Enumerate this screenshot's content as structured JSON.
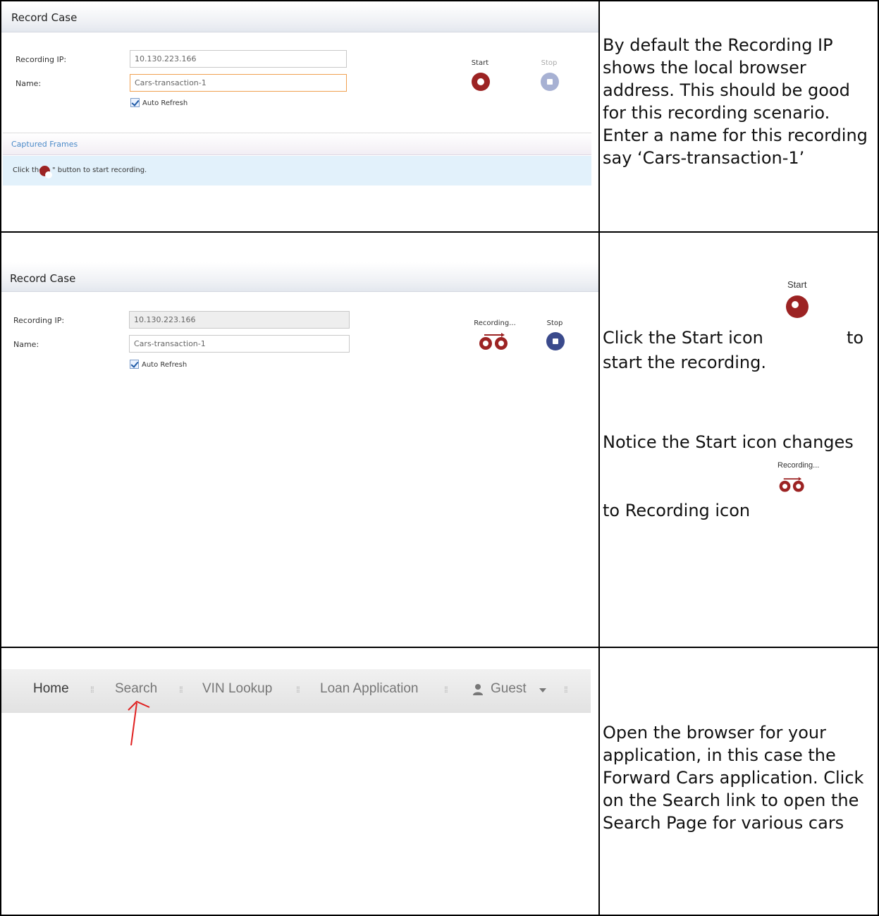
{
  "step1": {
    "panel_title": "Record Case",
    "recording_ip_label": "Recording IP:",
    "recording_ip_value": "10.130.223.166",
    "name_label": "Name:",
    "name_value": "Cars-transaction-1",
    "auto_refresh_label": "Auto Refresh",
    "start_label": "Start",
    "stop_label": "Stop",
    "captured_frames_label": "Captured Frames",
    "hint_prefix": "Click the \"",
    "hint_suffix": "\" button to start recording.",
    "instruction": "By default the Recording IP shows the local browser address. This should be good for this recording scenario. Enter a name for this recording say ‘Cars-transaction-1’"
  },
  "step2": {
    "panel_title": "Record Case",
    "recording_ip_label": "Recording IP:",
    "recording_ip_value": "10.130.223.166",
    "name_label": "Name:",
    "name_value": "Cars-transaction-1",
    "auto_refresh_label": "Auto Refresh",
    "recording_label": "Recording...",
    "stop_label": "Stop",
    "instruction_a1": "Click the Start icon",
    "instruction_a2": "to",
    "instruction_a3": "start the recording.",
    "start_label": "Start",
    "instruction_b1": "Notice the Start icon changes",
    "recording_label_small": "Recording...",
    "instruction_b2": "to Recording icon"
  },
  "step3": {
    "nav_items": [
      "Home",
      "Search",
      "VIN Lookup",
      "Loan Application",
      "Guest"
    ],
    "instruction": "Open the browser for your application, in this case the Forward Cars application. Click on the Search link to open the Search Page for various cars"
  },
  "colors": {
    "start_red": "#9c2323",
    "stop_disabled": "#a7b1d3",
    "stop_enabled": "#3a4a8c",
    "captured_link": "#4a8ac8",
    "arrow_red": "#e02020"
  }
}
